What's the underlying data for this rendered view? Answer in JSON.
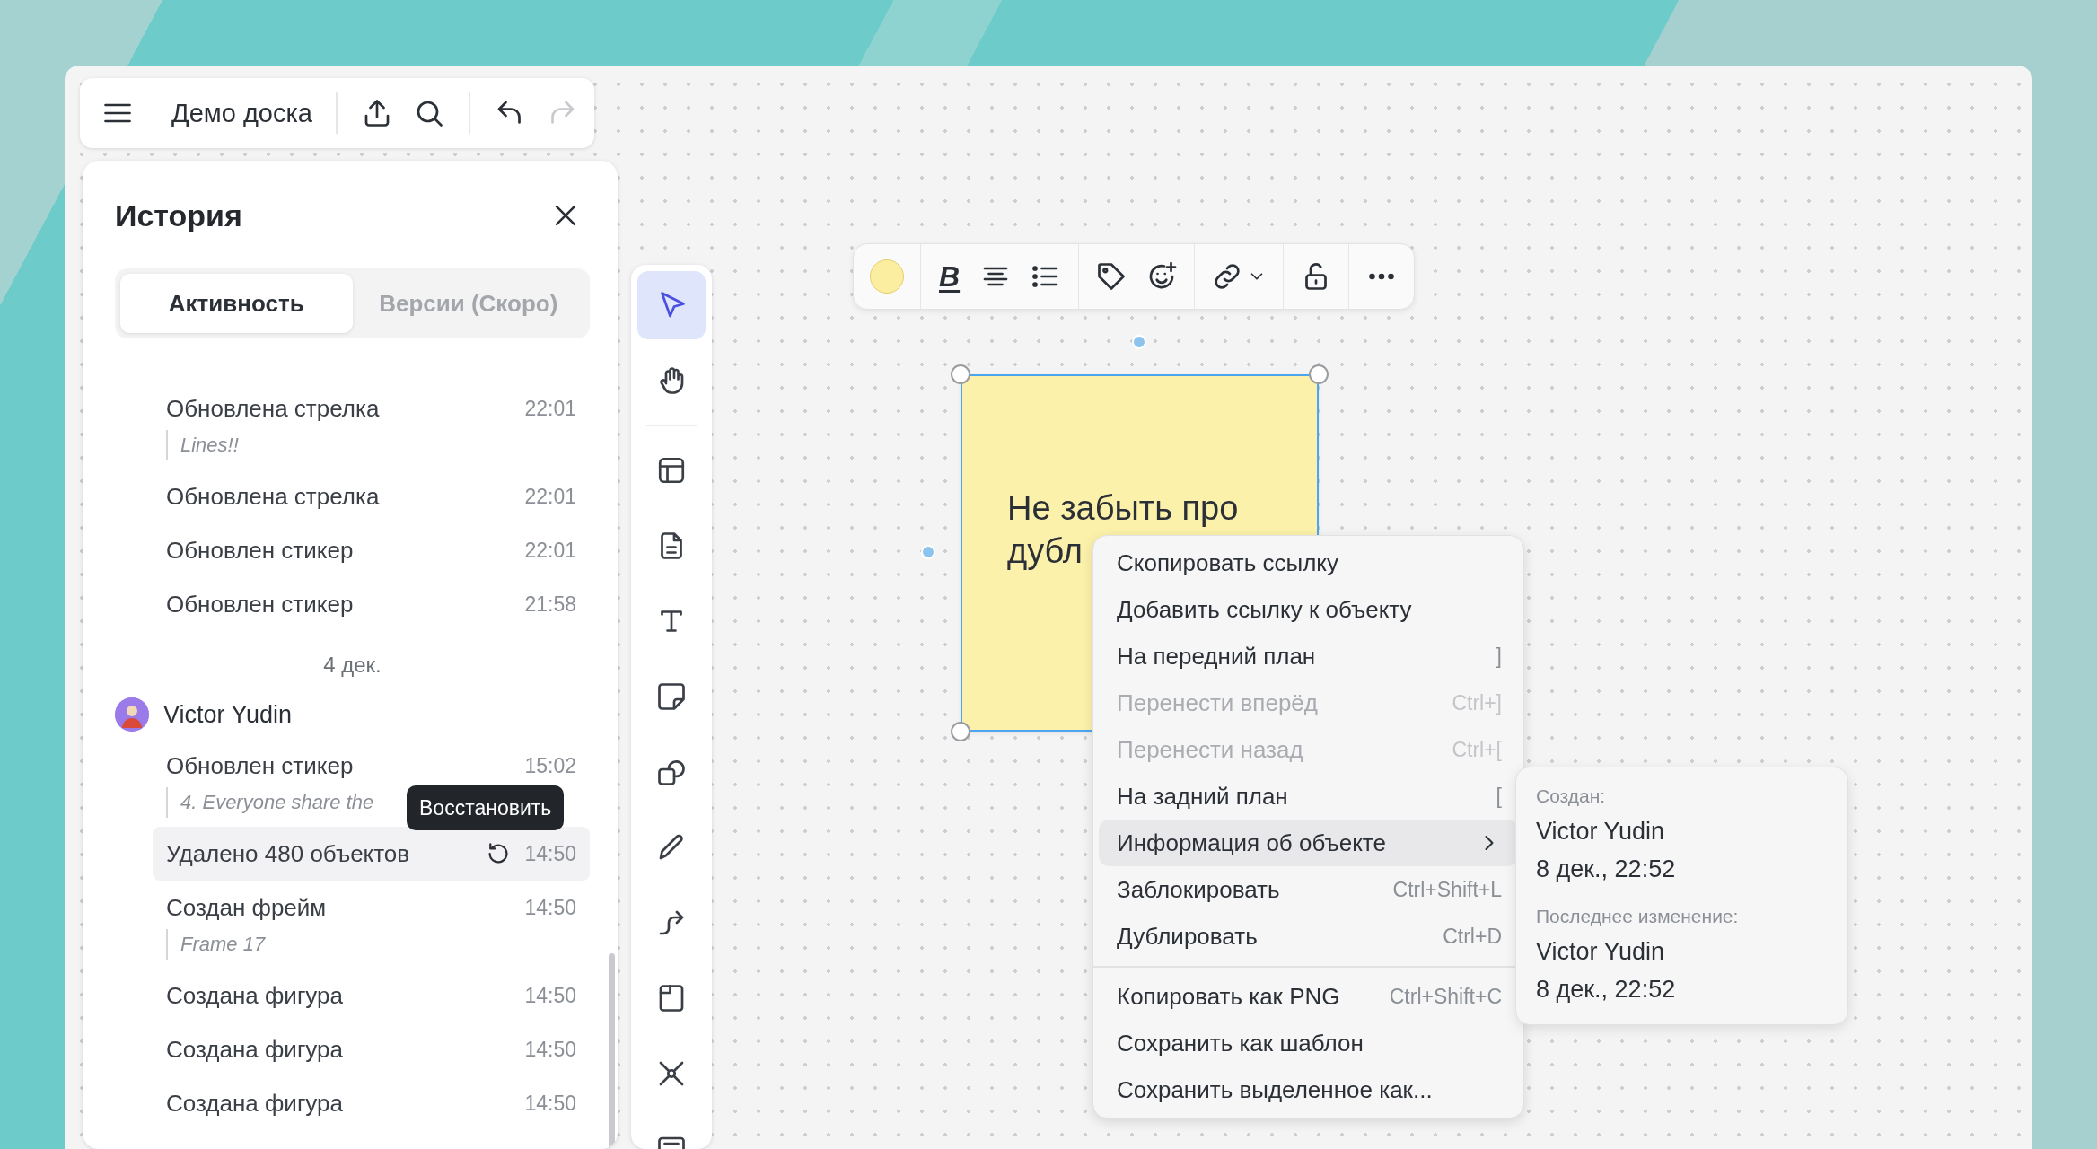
{
  "board": {
    "title": "Демо доска"
  },
  "toolbar": {
    "undo": {
      "disabled": false
    },
    "redo": {
      "disabled": true
    }
  },
  "history": {
    "title": "История",
    "tabs": [
      {
        "label": "Активность",
        "selected": true
      },
      {
        "label": "Версии (Скоро)",
        "selected": false
      }
    ],
    "entries": [
      {
        "kind": "action",
        "text": "Обновлена стрелка",
        "time": "22:01",
        "quote": "Lines!!",
        "highlighted": false
      },
      {
        "kind": "action",
        "text": "Обновлена стрелка",
        "time": "22:01",
        "highlighted": false
      },
      {
        "kind": "action",
        "text": "Обновлен стикер",
        "time": "22:01",
        "highlighted": false
      },
      {
        "kind": "action",
        "text": "Обновлен стикер",
        "time": "21:58",
        "highlighted": false
      },
      {
        "kind": "date",
        "text": "4 дек."
      },
      {
        "kind": "user",
        "text": "Victor Yudin"
      },
      {
        "kind": "action",
        "text": "Обновлен стикер",
        "time": "15:02",
        "quote": "4. Everyone share the",
        "highlighted": false
      },
      {
        "kind": "action",
        "text": "Удалено 480 объектов",
        "time": "14:50",
        "highlighted": true,
        "tooltip": "Восстановить"
      },
      {
        "kind": "action",
        "text": "Создан фрейм",
        "time": "14:50",
        "quote": "Frame 17",
        "highlighted": false
      },
      {
        "kind": "action",
        "text": "Создана фигура",
        "time": "14:50",
        "highlighted": false
      },
      {
        "kind": "action",
        "text": "Создана фигура",
        "time": "14:50",
        "highlighted": false
      },
      {
        "kind": "action",
        "text": "Создана фигура",
        "time": "14:50",
        "highlighted": false
      }
    ]
  },
  "tools": [
    {
      "selected": true
    },
    {
      "selected": false
    },
    {
      "selected": false
    },
    {
      "selected": false
    },
    {
      "selected": false
    },
    {
      "selected": false
    },
    {
      "selected": false
    },
    {
      "selected": false
    },
    {
      "selected": false
    },
    {
      "selected": false
    },
    {
      "selected": false
    },
    {
      "selected": false
    }
  ],
  "format_bar": {
    "bold_label": "B"
  },
  "sticky": {
    "lines": [
      "Не забыть про",
      "дубл"
    ],
    "selected": true
  },
  "context_menu": {
    "items": [
      {
        "kind": "item",
        "label": "Скопировать ссылку",
        "disabled": false,
        "selected": false
      },
      {
        "kind": "item",
        "label": "Добавить ссылку к объекту",
        "disabled": false,
        "selected": false
      },
      {
        "kind": "item",
        "label": "На передний план",
        "shortcut": "]",
        "disabled": false,
        "selected": false
      },
      {
        "kind": "item",
        "label": "Перенести вперёд",
        "shortcut": "Ctrl+]",
        "disabled": true,
        "selected": false
      },
      {
        "kind": "item",
        "label": "Перенести назад",
        "shortcut": "Ctrl+[",
        "disabled": true,
        "selected": false
      },
      {
        "kind": "item",
        "label": "На задний план",
        "shortcut": "[",
        "disabled": false,
        "selected": false
      },
      {
        "kind": "submenu",
        "label": "Информация об объекте",
        "disabled": false,
        "selected": true
      },
      {
        "kind": "item",
        "label": "Заблокировать",
        "shortcut": "Ctrl+Shift+L",
        "disabled": false,
        "selected": false
      },
      {
        "kind": "item",
        "label": "Дублировать",
        "shortcut": "Ctrl+D",
        "disabled": false,
        "selected": false
      },
      {
        "kind": "separator"
      },
      {
        "kind": "item",
        "label": "Копировать как PNG",
        "shortcut": "Ctrl+Shift+C",
        "disabled": false,
        "selected": false
      },
      {
        "kind": "item",
        "label": "Сохранить как шаблон",
        "disabled": false,
        "selected": false
      },
      {
        "kind": "item",
        "label": "Сохранить выделенное как...",
        "disabled": false,
        "selected": false
      }
    ]
  },
  "object_info": {
    "created_label": "Создан:",
    "created_by": "Victor Yudin",
    "created_at": "8 дек., 22:52",
    "modified_label": "Последнее изменение:",
    "modified_by": "Victor Yudin",
    "modified_at": "8 дек., 22:52"
  }
}
